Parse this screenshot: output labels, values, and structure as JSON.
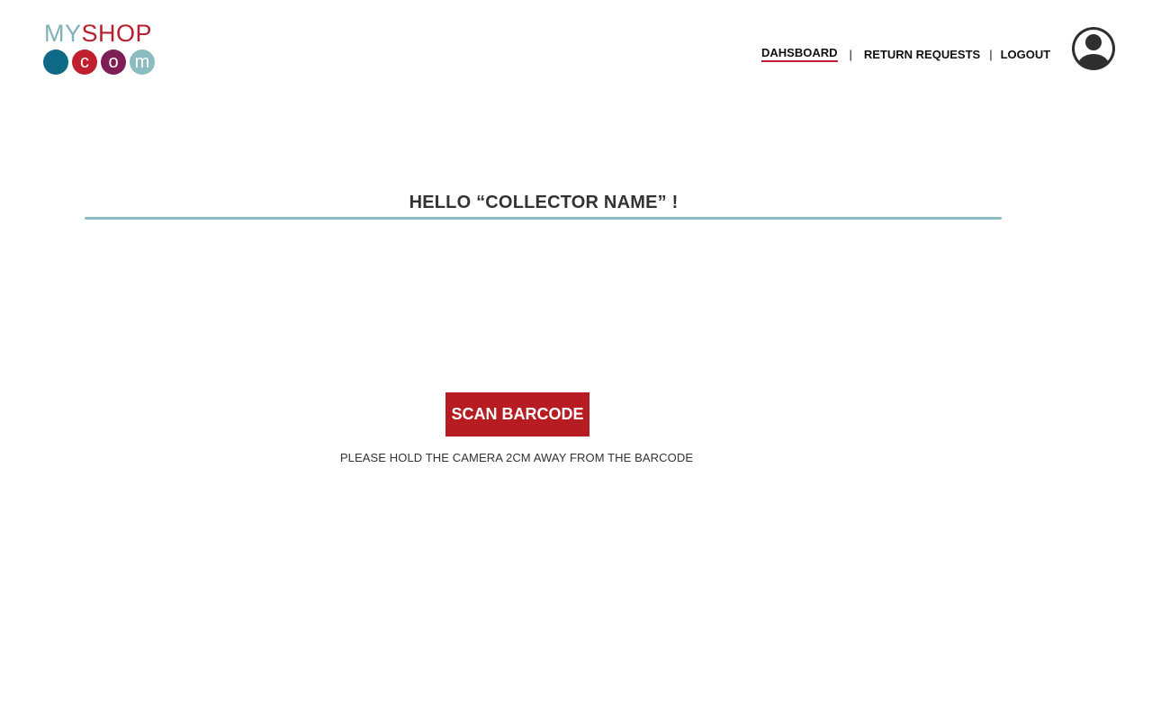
{
  "brand": {
    "logo_my": "MY",
    "logo_shop": "SHOP",
    "dots": [
      "",
      "c",
      "o",
      "m"
    ],
    "colors": {
      "teal": "#8bbcc0",
      "red": "#b5202e",
      "blue": "#0f6a88",
      "plum": "#7d1f55"
    }
  },
  "nav": {
    "items": [
      {
        "label": "DAHSBOARD",
        "active": true
      },
      {
        "label": "RETURN REQUESTS",
        "active": false
      },
      {
        "label": "LOGOUT",
        "active": false
      }
    ],
    "separator": "|"
  },
  "user": {
    "avatar_icon": "user-avatar-icon"
  },
  "main": {
    "greeting": "HELLO “COLLECTOR NAME” !",
    "scan_button_label": "SCAN BARCODE",
    "hint": "PLEASE HOLD THE CAMERA 2CM AWAY FROM THE BARCODE",
    "accent_color": "#b71c23"
  }
}
